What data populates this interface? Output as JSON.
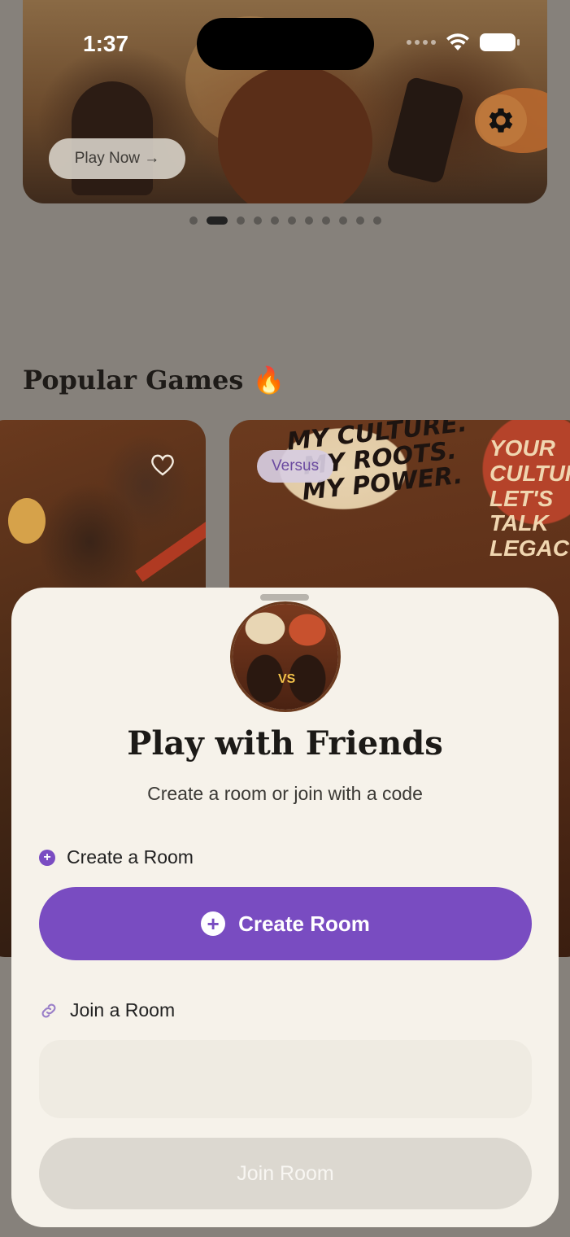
{
  "status_bar": {
    "time": "1:37",
    "icons": [
      "signal-icon",
      "wifi-icon",
      "battery-icon"
    ]
  },
  "hero": {
    "play_now_label": "Play Now →",
    "settings_icon": "gear-icon",
    "carousel": {
      "count": 11,
      "active_index": 1
    }
  },
  "popular": {
    "title": "Popular Games 🔥",
    "cards": [
      {
        "art_text": "",
        "favorite_icon": "heart-outline-icon"
      },
      {
        "badge": "Versus",
        "art_text_1": "MY CULTURE. MY ROOTS. MY POWER.",
        "art_text_2": "YOUR CULTURE. LET'S TALK LEGACY!"
      }
    ]
  },
  "sheet": {
    "title": "Play with Friends",
    "subtitle": "Create a room or join with a code",
    "create_section_label": "Create a Room",
    "create_button_label": "Create Room",
    "join_section_label": "Join a Room",
    "code_input_value": "",
    "join_button_label": "Join Room"
  },
  "colors": {
    "accent": "#794cc1",
    "sheet_bg": "#f6f2ea",
    "disabled_button": "#dcd8d0"
  }
}
